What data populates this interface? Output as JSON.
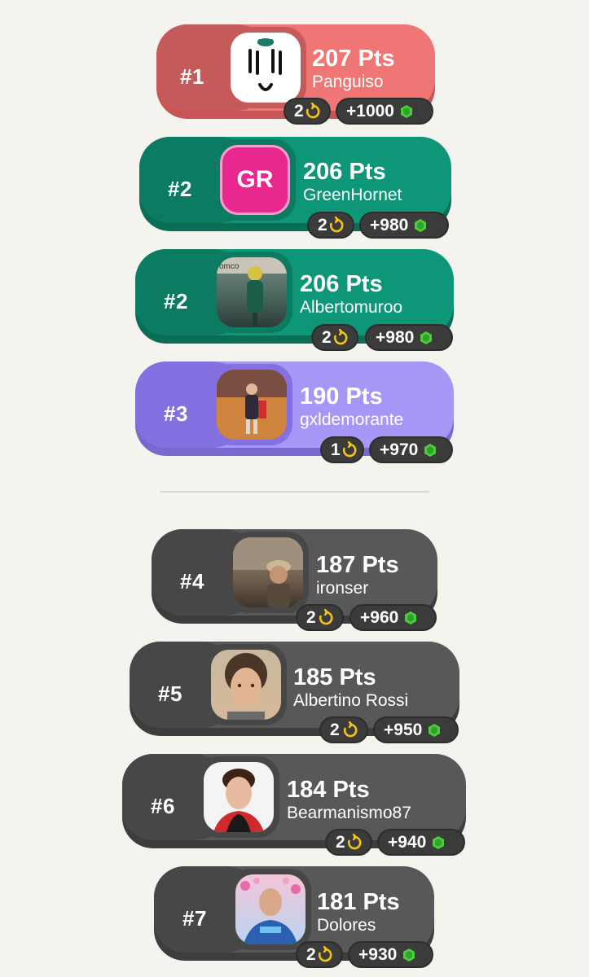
{
  "leaderboard": {
    "entries": [
      {
        "rank": "#1",
        "points": "207 Pts",
        "username": "Panguiso",
        "badge_count": "2",
        "reward": "+1000",
        "theme": "red",
        "avatar": "hat-drawing-avatar"
      },
      {
        "rank": "#2",
        "points": "206 Pts",
        "username": "GreenHornet",
        "badge_count": "2",
        "reward": "+980",
        "theme": "green",
        "avatar": "initials",
        "initials": "GR"
      },
      {
        "rank": "#2",
        "points": "206 Pts",
        "username": "Albertomuroo",
        "badge_count": "2",
        "reward": "+980",
        "theme": "green",
        "avatar": "photo-driver-green"
      },
      {
        "rank": "#3",
        "points": "190 Pts",
        "username": "gxldemorante",
        "badge_count": "1",
        "reward": "+970",
        "theme": "purple",
        "avatar": "photo-bullring"
      },
      {
        "rank": "#4",
        "points": "187 Pts",
        "username": "ironser",
        "badge_count": "2",
        "reward": "+960",
        "theme": "gray",
        "avatar": "photo-desert-man"
      },
      {
        "rank": "#5",
        "points": "185 Pts",
        "username": "Albertino Rossi",
        "badge_count": "2",
        "reward": "+950",
        "theme": "gray",
        "avatar": "photo-curly-hair"
      },
      {
        "rank": "#6",
        "points": "184 Pts",
        "username": "Bearmanismo87",
        "badge_count": "2",
        "reward": "+940",
        "theme": "gray",
        "avatar": "photo-young-driver"
      },
      {
        "rank": "#7",
        "points": "181 Pts",
        "username": "Dolores",
        "badge_count": "2",
        "reward": "+930",
        "theme": "gray",
        "avatar": "photo-flower-driver"
      }
    ]
  },
  "colors": {
    "background": "#f4f3ee",
    "first_place": "#f07676",
    "second_place": "#0e9678",
    "third_place": "#a896f7",
    "others": "#585858",
    "coin": "#f2c318",
    "gem": "#4ccf3a"
  },
  "icons": {
    "badge": "refresh-coin-icon",
    "reward": "green-gem-icon"
  }
}
